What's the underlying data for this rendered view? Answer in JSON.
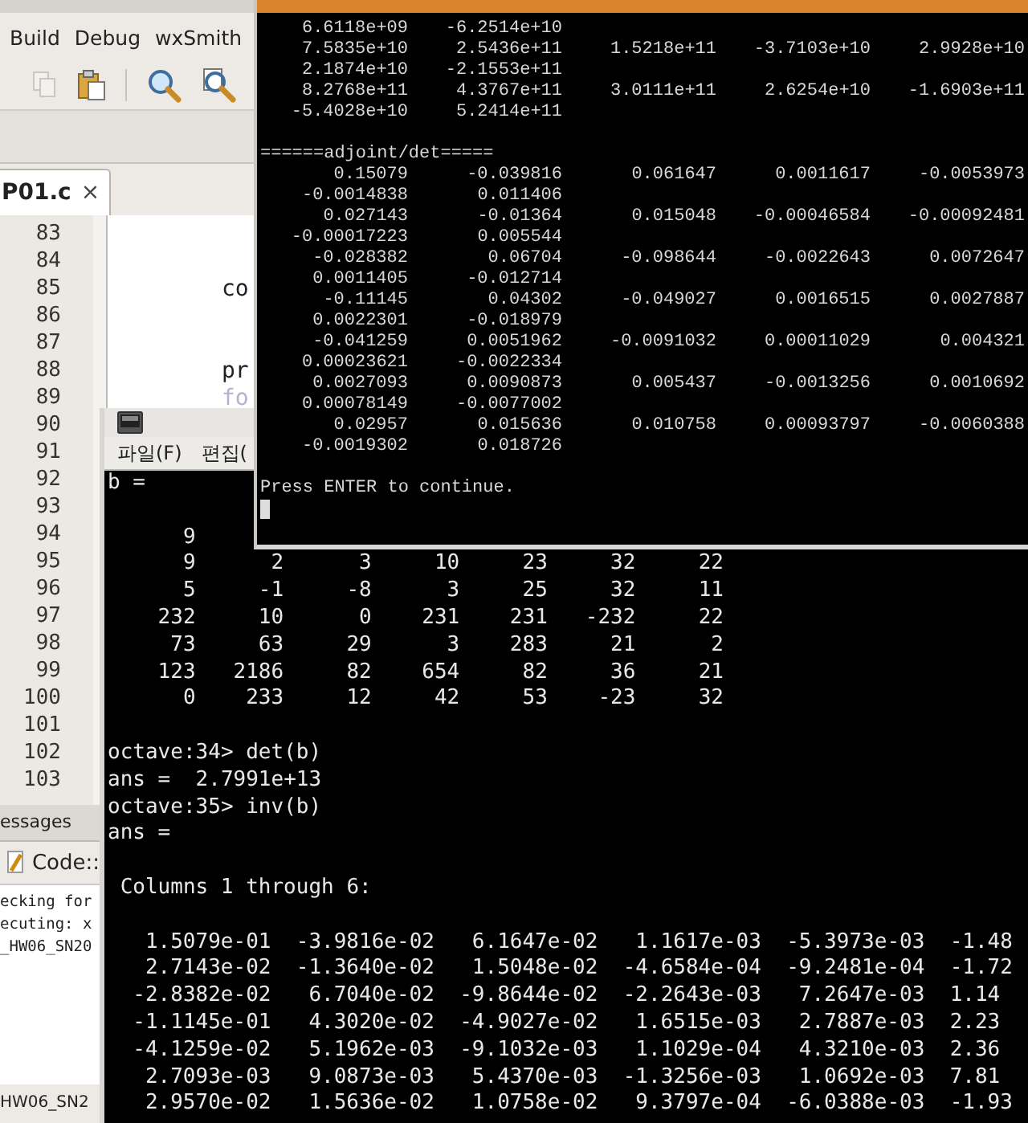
{
  "ide": {
    "menu": [
      "Build",
      "Debug",
      "wxSmith"
    ],
    "editor_tab": {
      "label": "P01.c",
      "close": "×"
    },
    "lines": [
      {
        "number": "83"
      },
      {
        "number": "84"
      },
      {
        "number": "85",
        "code": "co"
      },
      {
        "number": "86"
      },
      {
        "number": "87"
      },
      {
        "number": "88",
        "code": "pr"
      },
      {
        "number": "89",
        "code": "fo"
      },
      {
        "number": "90"
      },
      {
        "number": "91"
      },
      {
        "number": "92"
      },
      {
        "number": "93"
      },
      {
        "number": "94"
      },
      {
        "number": "95"
      },
      {
        "number": "96"
      },
      {
        "number": "97"
      },
      {
        "number": "98"
      },
      {
        "number": "99"
      },
      {
        "number": "100"
      },
      {
        "number": "101"
      },
      {
        "number": "102"
      },
      {
        "number": "103"
      }
    ],
    "messages_panel": {
      "tab": "essages",
      "log_tab": "Code::",
      "log_lines": [
        "ecking for",
        "ecuting: x",
        "_HW06_SN20"
      ],
      "status": "HW06_SN2"
    }
  },
  "octave_window": {
    "menu": [
      "파일(F)",
      "편집("
    ],
    "lines": [
      {
        "kind": "text",
        "text": "b ="
      },
      {
        "kind": "blank"
      },
      {
        "kind": "introw",
        "cells": [
          "9"
        ]
      },
      {
        "kind": "introw",
        "cells": [
          "9",
          "2",
          "3",
          "10",
          "23",
          "32",
          "22"
        ]
      },
      {
        "kind": "introw",
        "cells": [
          "5",
          "-1",
          "-8",
          "3",
          "25",
          "32",
          "11"
        ]
      },
      {
        "kind": "introw",
        "cells": [
          "232",
          "10",
          "0",
          "231",
          "231",
          "-232",
          "22"
        ]
      },
      {
        "kind": "introw",
        "cells": [
          "73",
          "63",
          "29",
          "3",
          "283",
          "21",
          "2"
        ]
      },
      {
        "kind": "introw",
        "cells": [
          "123",
          "2186",
          "82",
          "654",
          "82",
          "36",
          "21"
        ]
      },
      {
        "kind": "introw",
        "cells": [
          "0",
          "233",
          "12",
          "42",
          "53",
          "-23",
          "32"
        ]
      },
      {
        "kind": "blank"
      },
      {
        "kind": "text",
        "text": "octave:34> det(b)"
      },
      {
        "kind": "text",
        "text": "ans =  2.7991e+13"
      },
      {
        "kind": "text",
        "text": "octave:35> inv(b)"
      },
      {
        "kind": "text",
        "text": "ans ="
      },
      {
        "kind": "blank"
      },
      {
        "kind": "heading",
        "text": "Columns 1 through 6:"
      },
      {
        "kind": "blank"
      },
      {
        "kind": "floatrow",
        "cells": [
          "1.5079e-01",
          "-3.9816e-02",
          "6.1647e-02",
          "1.1617e-03",
          "-5.3973e-03",
          "-1.48"
        ]
      },
      {
        "kind": "floatrow",
        "cells": [
          "2.7143e-02",
          "-1.3640e-02",
          "1.5048e-02",
          "-4.6584e-04",
          "-9.2481e-04",
          "-1.72"
        ]
      },
      {
        "kind": "floatrow",
        "cells": [
          "-2.8382e-02",
          "6.7040e-02",
          "-9.8644e-02",
          "-2.2643e-03",
          "7.2647e-03",
          "1.14"
        ]
      },
      {
        "kind": "floatrow",
        "cells": [
          "-1.1145e-01",
          "4.3020e-02",
          "-4.9027e-02",
          "1.6515e-03",
          "2.7887e-03",
          "2.23"
        ]
      },
      {
        "kind": "floatrow",
        "cells": [
          "-4.1259e-02",
          "5.1962e-03",
          "-9.1032e-03",
          "1.1029e-04",
          "4.3210e-03",
          "2.36"
        ]
      },
      {
        "kind": "floatrow",
        "cells": [
          "2.7093e-03",
          "9.0873e-03",
          "5.4370e-03",
          "-1.3256e-03",
          "1.0692e-03",
          "7.81"
        ]
      },
      {
        "kind": "floatrow",
        "cells": [
          "2.9570e-02",
          "1.5636e-02",
          "1.0758e-02",
          "9.3797e-04",
          "-6.0388e-03",
          "-1.93"
        ]
      }
    ]
  },
  "console_window": {
    "lines": [
      {
        "kind": "row",
        "cells": [
          "6.6118e+09",
          "-6.2514e+10"
        ]
      },
      {
        "kind": "row",
        "cells": [
          "7.5835e+10",
          "2.5436e+11",
          "1.5218e+11",
          "-3.7103e+10",
          "2.9928e+10"
        ]
      },
      {
        "kind": "row",
        "cells": [
          "2.1874e+10",
          "-2.1553e+11"
        ]
      },
      {
        "kind": "row",
        "cells": [
          "8.2768e+11",
          "4.3767e+11",
          "3.0111e+11",
          "2.6254e+10",
          "-1.6903e+11"
        ]
      },
      {
        "kind": "row",
        "cells": [
          "-5.4028e+10",
          "5.2414e+11"
        ]
      },
      {
        "kind": "blank"
      },
      {
        "kind": "text",
        "text": "======adjoint/det====="
      },
      {
        "kind": "row",
        "cells": [
          "0.15079",
          "-0.039816",
          "0.061647",
          "0.0011617",
          "-0.0053973"
        ]
      },
      {
        "kind": "row",
        "cells": [
          "-0.0014838",
          "0.011406"
        ]
      },
      {
        "kind": "row",
        "cells": [
          "0.027143",
          "-0.01364",
          "0.015048",
          "-0.00046584",
          "-0.00092481"
        ]
      },
      {
        "kind": "row",
        "cells": [
          "-0.00017223",
          "0.005544"
        ]
      },
      {
        "kind": "row",
        "cells": [
          "-0.028382",
          "0.06704",
          "-0.098644",
          "-0.0022643",
          "0.0072647"
        ]
      },
      {
        "kind": "row",
        "cells": [
          "0.0011405",
          "-0.012714"
        ]
      },
      {
        "kind": "row",
        "cells": [
          "-0.11145",
          "0.04302",
          "-0.049027",
          "0.0016515",
          "0.0027887"
        ]
      },
      {
        "kind": "row",
        "cells": [
          "0.0022301",
          "-0.018979"
        ]
      },
      {
        "kind": "row",
        "cells": [
          "-0.041259",
          "0.0051962",
          "-0.0091032",
          "0.00011029",
          "0.004321"
        ]
      },
      {
        "kind": "row",
        "cells": [
          "0.00023621",
          "-0.0022334"
        ]
      },
      {
        "kind": "row",
        "cells": [
          "0.0027093",
          "0.0090873",
          "0.005437",
          "-0.0013256",
          "0.0010692"
        ]
      },
      {
        "kind": "row",
        "cells": [
          "0.00078149",
          "-0.0077002"
        ]
      },
      {
        "kind": "row",
        "cells": [
          "0.02957",
          "0.015636",
          "0.010758",
          "0.00093797",
          "-0.0060388"
        ]
      },
      {
        "kind": "row",
        "cells": [
          "-0.0019302",
          "0.018726"
        ]
      },
      {
        "kind": "blank"
      },
      {
        "kind": "text",
        "text": "Press ENTER to continue."
      },
      {
        "kind": "cursor"
      }
    ]
  }
}
